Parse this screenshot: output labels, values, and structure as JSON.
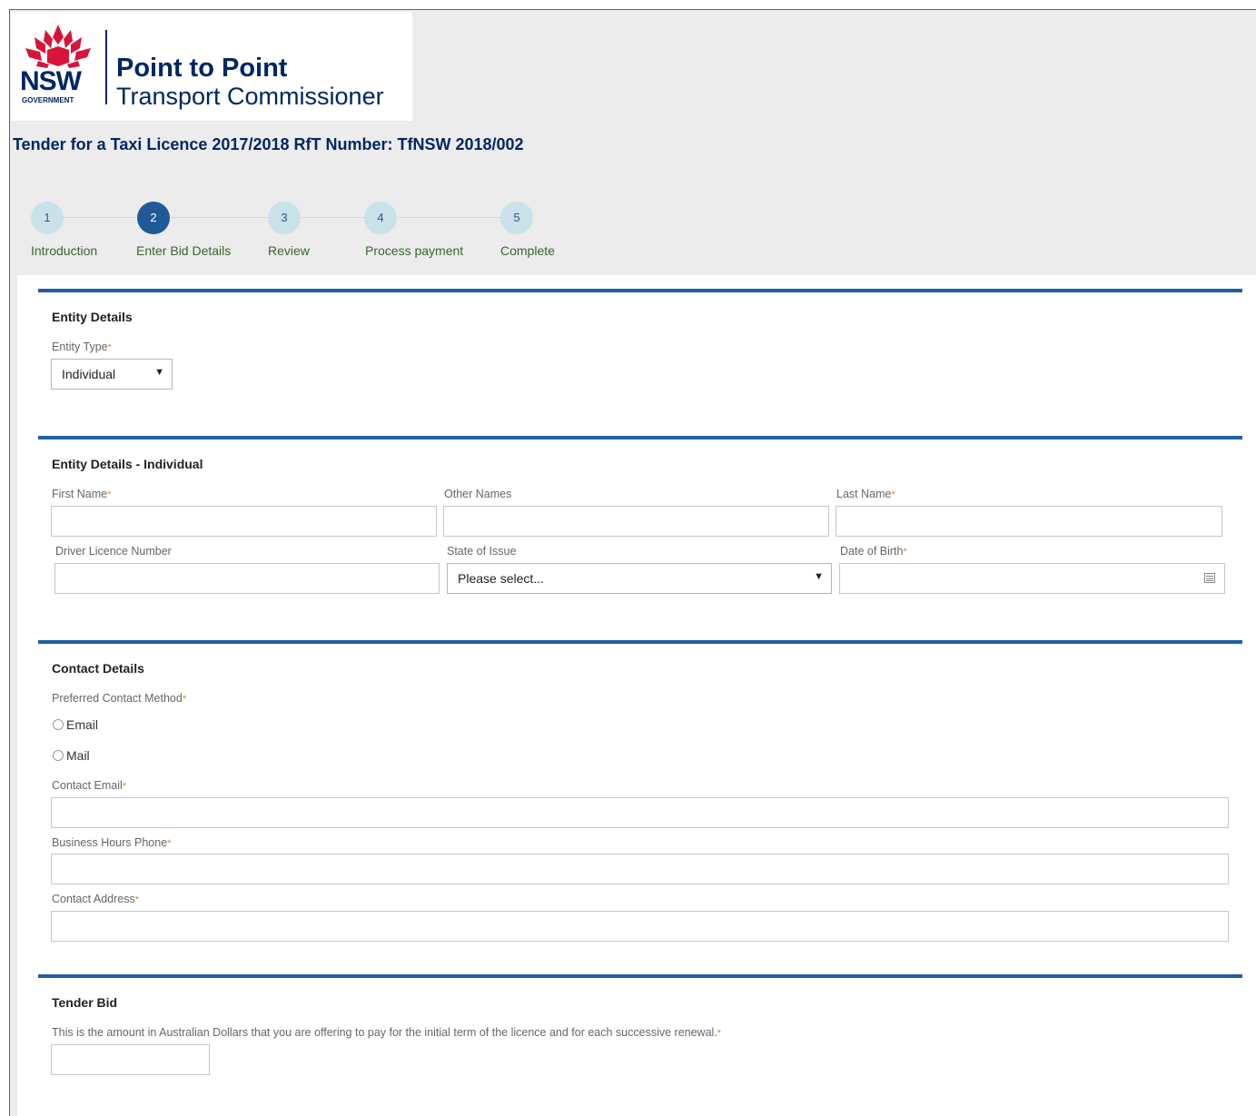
{
  "header": {
    "brand_short": "NSW",
    "brand_gov": "GOVERNMENT",
    "brand_line1": "Point to Point",
    "brand_line2": "Transport Commissioner",
    "page_title": "Tender for a Taxi Licence 2017/2018 RfT Number: TfNSW 2018/002"
  },
  "steps": [
    {
      "num": "1",
      "label": "Introduction"
    },
    {
      "num": "2",
      "label": "Enter Bid Details"
    },
    {
      "num": "3",
      "label": "Review"
    },
    {
      "num": "4",
      "label": "Process payment"
    },
    {
      "num": "5",
      "label": "Complete"
    }
  ],
  "active_step": 2,
  "colors": {
    "accent": "#1f5fa6",
    "brand": "#002664",
    "step_label": "#3a6431",
    "required": "#e08a2a"
  },
  "entity": {
    "title": "Entity Details",
    "type_label": "Entity Type",
    "type_value": "Individual"
  },
  "individual": {
    "title": "Entity Details - Individual",
    "first_name_label": "First Name",
    "other_names_label": "Other Names",
    "last_name_label": "Last Name",
    "licence_label": "Driver Licence Number",
    "state_label": "State of Issue",
    "state_value": "Please select...",
    "dob_label": "Date of Birth"
  },
  "contact": {
    "title": "Contact Details",
    "method_label": "Preferred Contact Method",
    "option_email": "Email",
    "option_mail": "Mail",
    "email_label": "Contact Email",
    "phone_label": "Business Hours Phone",
    "address_label": "Contact Address"
  },
  "bid": {
    "title": "Tender Bid",
    "description": "This is the amount in Australian Dollars that you are offering to pay for the initial term of the licence and for each successive renewal."
  },
  "required_mark": "*",
  "select_arrow": "▼"
}
